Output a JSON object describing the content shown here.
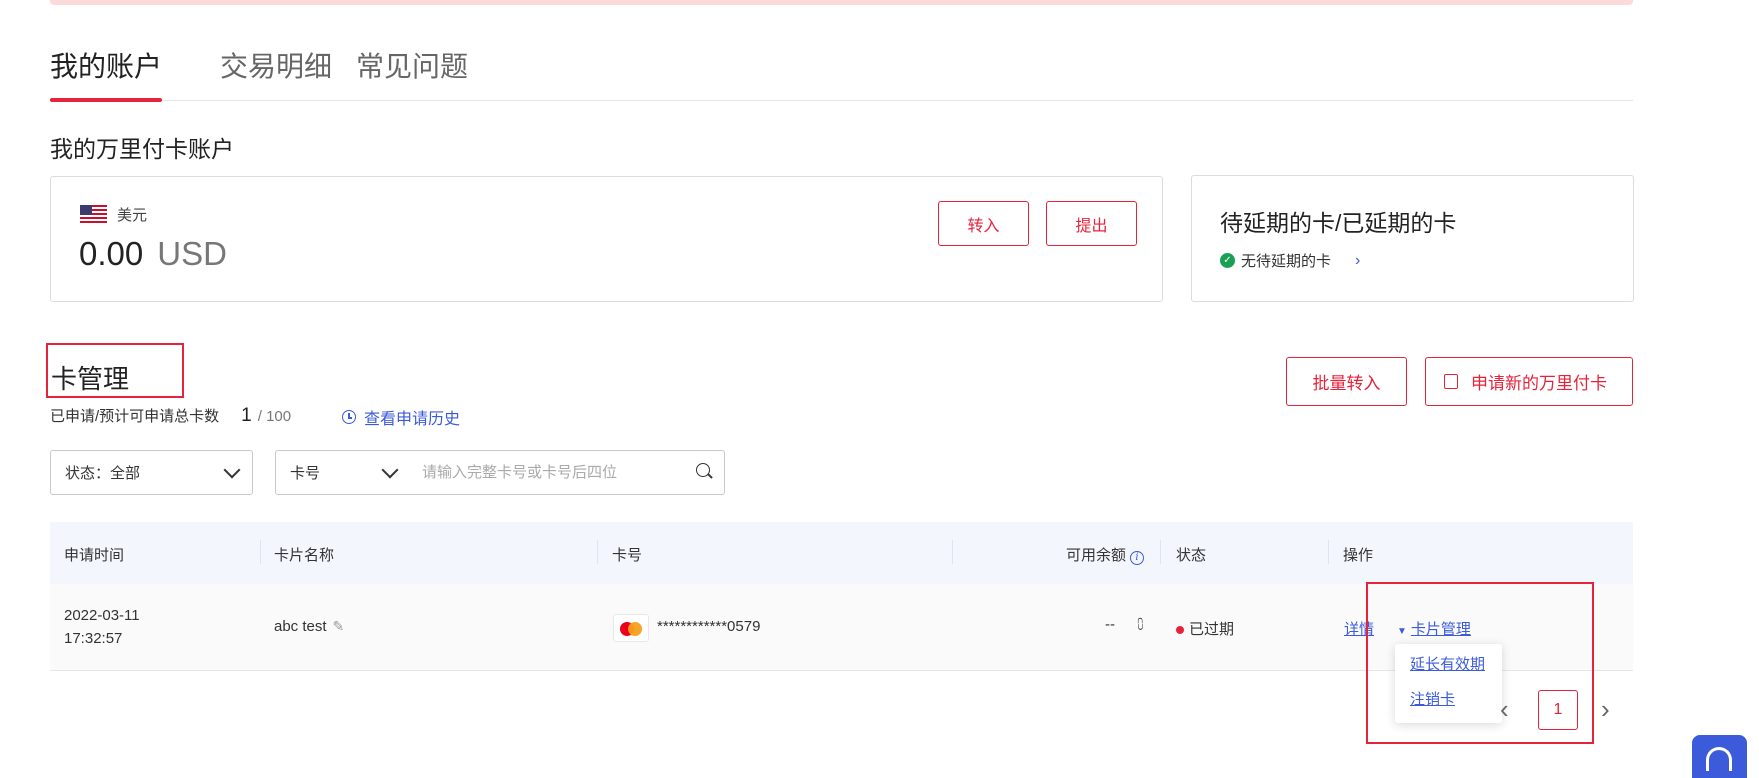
{
  "tabs": [
    {
      "label": "我的账户",
      "active": true
    },
    {
      "label": "交易明细",
      "active": false
    },
    {
      "label": "常见问题",
      "active": false
    }
  ],
  "account_section": {
    "title": "我的万里付卡账户",
    "currency_label": "美元",
    "amount": "0.00",
    "unit": "USD",
    "transfer_in_label": "转入",
    "withdraw_label": "提出"
  },
  "pending_card": {
    "title": "待延期的卡/已延期的卡",
    "status_text": "无待延期的卡"
  },
  "card_management": {
    "title": "卡管理",
    "quota_label": "已申请/预计可申请总卡数",
    "quota_used": "1",
    "quota_total": "/ 100",
    "history_link": "查看申请历史",
    "batch_transfer_label": "批量转入",
    "apply_new_label": "申请新的万里付卡"
  },
  "filters": {
    "status_select": "状态：全部",
    "field_select": "卡号",
    "search_placeholder": "请输入完整卡号或卡号后四位"
  },
  "table": {
    "headers": [
      "申请时间",
      "卡片名称",
      "卡号",
      "可用余额",
      "状态",
      "操作"
    ],
    "rows": [
      {
        "date": "2022-03-11",
        "time": "17:32:57",
        "name": "abc test",
        "card_number": "************0579",
        "balance": "--",
        "status": "已过期",
        "action_detail": "详情",
        "action_manage": "卡片管理"
      }
    ]
  },
  "dropdown": {
    "items": [
      "延长有效期",
      "注销卡"
    ]
  },
  "pagination": {
    "current_page": "1"
  },
  "colors": {
    "accent": "#e5233a",
    "link": "#3b5bdb",
    "table_header_bg": "#f3f6fd"
  }
}
